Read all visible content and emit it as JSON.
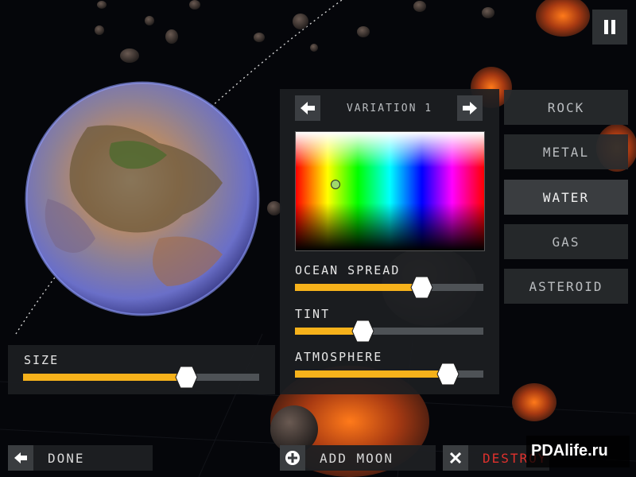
{
  "hud": {
    "pause_icon": "pause-icon"
  },
  "variation": {
    "label": "VARIATION 1",
    "prev_icon": "arrow-left-icon",
    "next_icon": "arrow-right-icon"
  },
  "sliders": [
    {
      "label": "OCEAN SPREAD",
      "value": 0.67
    },
    {
      "label": "TINT",
      "value": 0.36
    },
    {
      "label": "ATMOSPHERE",
      "value": 0.81
    }
  ],
  "size": {
    "label": "SIZE",
    "value": 0.69
  },
  "materials": [
    {
      "label": "ROCK",
      "active": false
    },
    {
      "label": "METAL",
      "active": false
    },
    {
      "label": "WATER",
      "active": true
    },
    {
      "label": "GAS",
      "active": false
    },
    {
      "label": "ASTEROID",
      "active": false
    }
  ],
  "bottom": {
    "done_label": "DONE",
    "add_moon_label": "ADD MOON",
    "destroy_label": "DESTROY"
  },
  "watermark": "PDAlife.ru",
  "colors": {
    "accent": "#f6b21b",
    "destroy": "#e0312d"
  }
}
